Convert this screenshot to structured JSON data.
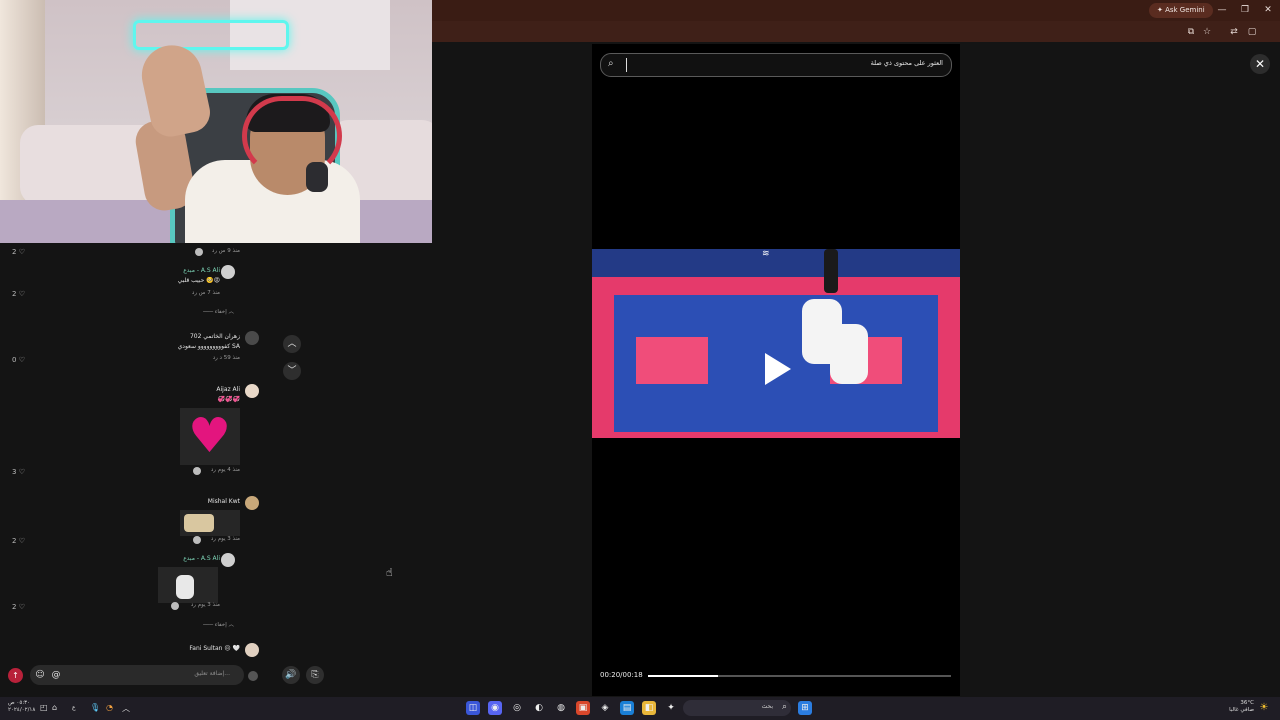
{
  "browser": {
    "gemini_label": "Ask Gemini",
    "min": "—",
    "restore": "❐",
    "close": "✕",
    "toolbar_icons": [
      "⧉",
      "☆",
      "⇄",
      "▢"
    ]
  },
  "comments": [
    {
      "likes": "2",
      "meta": "منذ 9 س  رد"
    },
    {
      "likes": "2",
      "user": "مبدع - A.S Ali",
      "text": "حبيب قلبي 🥺😡",
      "meta": "منذ 7 س  رد",
      "hide": "إخفاء"
    },
    {
      "likes": "0",
      "user": "702 زهران الخاتمي",
      "text": "كفووووووووو سعودي SA",
      "meta": "منذ 59 د  رد"
    },
    {
      "likes": "3",
      "user": "Aijaz Ali",
      "text": "💞💞💞",
      "meta": "منذ 4 يوم  رد"
    },
    {
      "likes": "2",
      "user": "Mishal Kwt",
      "meta": "منذ 3 يوم  رد"
    },
    {
      "likes": "2",
      "user": "مبدع - A.S Ali",
      "meta": "منذ 3 يوم  رد",
      "hide": "إخفاء"
    },
    {
      "user": "Fani Sultan 😔 🤍"
    }
  ],
  "nav": {
    "up": "︿",
    "down": "﹀"
  },
  "composer": {
    "placeholder": "إضافة تعليق...",
    "emoji": "☺",
    "mention": "@",
    "send": "↑",
    "volume": "🔊",
    "share": "⎘"
  },
  "player": {
    "search_text": "العثور على محتوى ذي صلة",
    "search_icon": "⌕",
    "timecode": "00:20/00:18",
    "progress": 0.23,
    "close": "✕"
  },
  "taskbar": {
    "time": "٠٥:٣٠ ص",
    "date": "٢٠٢٤/٠٢/١٨",
    "search_label": "بحث",
    "weather_temp": "36°C",
    "weather_desc": "صافي غالبا",
    "lang": "ع",
    "icons": [
      "◫",
      "◉",
      "◎",
      "◐",
      "◍",
      "▣",
      "◈",
      "▤",
      "◧",
      "✦"
    ]
  }
}
